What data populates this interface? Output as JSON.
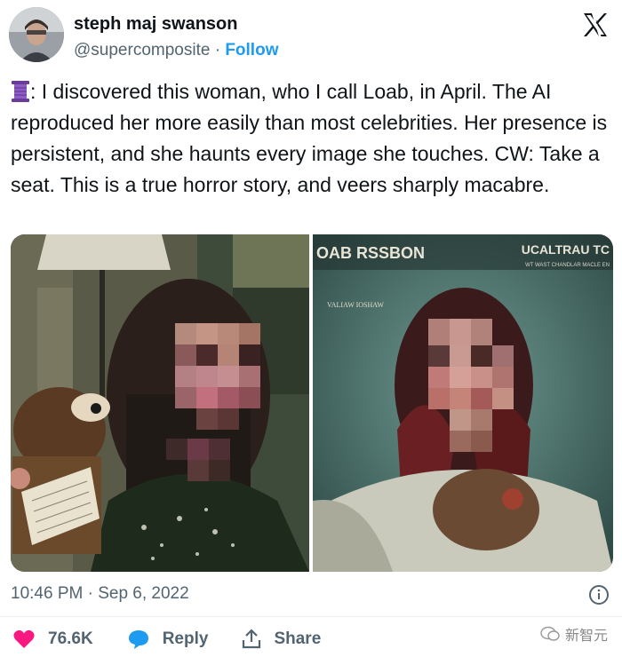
{
  "author": {
    "name": "steph maj swanson",
    "handle": "@supercomposite",
    "separator": "·",
    "follow_label": "Follow"
  },
  "tweet": {
    "emoji_icon": "spool-of-thread-icon",
    "text": ": I discovered this woman, who I call Loab, in April. The AI reproduced her more easily than most celebrities. Her presence is persistent, and she haunts every image she touches. CW: Take a seat. This is a true horror story, and veers sharply macabre."
  },
  "media": {
    "right_image": {
      "top_left_text": "OAB RSSBON",
      "top_right_text": "UCALTRAU TC",
      "subtitle_small": "WT WAST CHANDLAR MACLE EN",
      "mid_text": "VALIAW IOSHAW"
    }
  },
  "meta": {
    "timestamp": "10:46 PM · Sep 6, 2022"
  },
  "actions": {
    "likes": "76.6K",
    "reply_label": "Reply",
    "share_label": "Share"
  },
  "watermark": {
    "text": "新智元"
  },
  "colors": {
    "accent": "#1d9bf0",
    "like": "#f91880",
    "text": "#0f1419",
    "muted": "#536471"
  }
}
